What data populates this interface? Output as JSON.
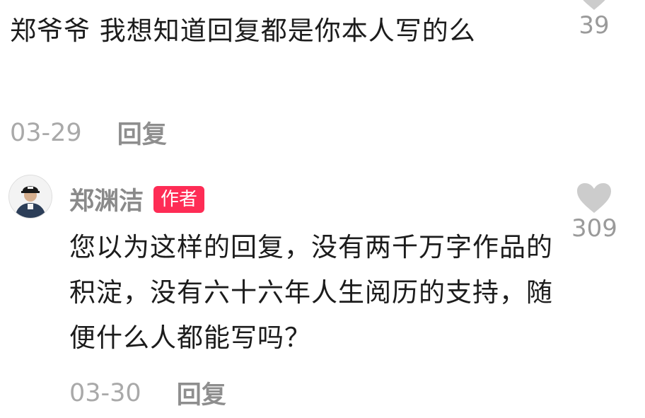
{
  "top_comment": {
    "text": "郑爷爷 我想知道回复都是你本人写的么",
    "date": "03-29",
    "reply_label": "回复",
    "like_count": "39"
  },
  "author_reply": {
    "author_name": "郑渊洁",
    "author_badge": "作者",
    "text": "您以为这样的回复，没有两千万字作品的积淀，没有六十六年人生阅历的支持，随便什么人都能写吗？",
    "date": "03-30",
    "reply_label": "回复",
    "like_count": "309"
  },
  "colors": {
    "badge": "#fe2c55",
    "heart": "#cccccc",
    "muted_text": "#a9a9a9"
  },
  "icons": {
    "like": "heart-icon",
    "avatar": "user-avatar"
  }
}
